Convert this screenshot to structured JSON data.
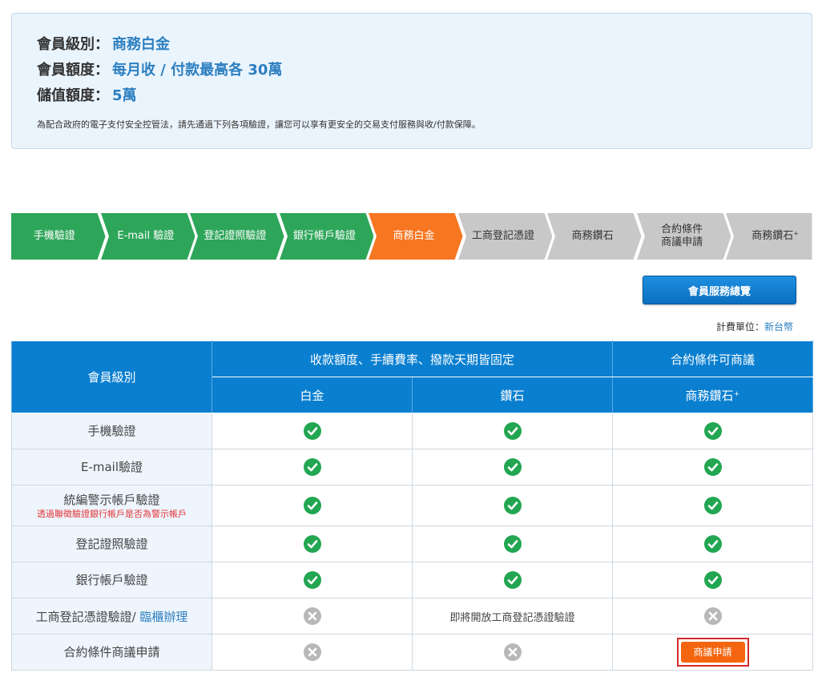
{
  "info": {
    "level_label": "會員級別：",
    "level_value": "商務白金",
    "quota_label": "會員額度：",
    "quota_value": "每月收 / 付款最高各 30萬",
    "stored_label": "儲值額度：",
    "stored_value": "5萬",
    "note": "為配合政府的電子支付安全控管法，請先通過下列各項驗證，讓您可以享有更安全的交易支付服務與收/付款保障。"
  },
  "steps": [
    {
      "label": "手機驗證",
      "state": "done"
    },
    {
      "label": "E-mail 驗證",
      "state": "done"
    },
    {
      "label": "登記證照驗證",
      "state": "done"
    },
    {
      "label": "銀行帳戶驗證",
      "state": "done"
    },
    {
      "label": "商務白金",
      "state": "current"
    },
    {
      "label": "工商登記憑證",
      "state": "todo"
    },
    {
      "label": "商務鑽石",
      "state": "todo"
    },
    {
      "label": "合約條件\n商議申請",
      "state": "todo"
    },
    {
      "label": "商務鑽石⁺",
      "state": "todo"
    }
  ],
  "colors": {
    "done": "#2ea65a",
    "current": "#f67621",
    "todo": "#c8c8c8",
    "check": "#22a651",
    "cross": "#b8b8b8"
  },
  "overview_button": "會員服務總覽",
  "unit_note": {
    "label": "計費單位：",
    "currency": "新台幣"
  },
  "table": {
    "header_level": "會員級別",
    "group_fixed": "收款額度、手續費率、撥款天期皆固定",
    "group_negotiable": "合約條件可商議",
    "col_platinum": "白金",
    "col_diamond": "鑽石",
    "col_biz_diamond": "商務鑽石⁺",
    "rows": [
      {
        "label": "手機驗證",
        "cells": [
          "check",
          "check",
          "check"
        ]
      },
      {
        "label": "E-mail驗證",
        "cells": [
          "check",
          "check",
          "check"
        ]
      },
      {
        "label": "統編警示帳戶驗證",
        "sub": "透過聯徵驗證銀行帳戶是否為警示帳戶",
        "cells": [
          "check",
          "check",
          "check"
        ]
      },
      {
        "label": "登記證照驗證",
        "cells": [
          "check",
          "check",
          "check"
        ]
      },
      {
        "label": "銀行帳戶驗證",
        "cells": [
          "check",
          "check",
          "check"
        ]
      },
      {
        "label": "工商登記憑證驗證/ ",
        "link": "臨櫃辦理",
        "cells": [
          "cross",
          "即將開放工商登記憑證驗證",
          "cross"
        ]
      },
      {
        "label": "合約條件商議申請",
        "cells": [
          "cross",
          "cross",
          "apply"
        ]
      }
    ],
    "apply_button": "商議申請"
  }
}
